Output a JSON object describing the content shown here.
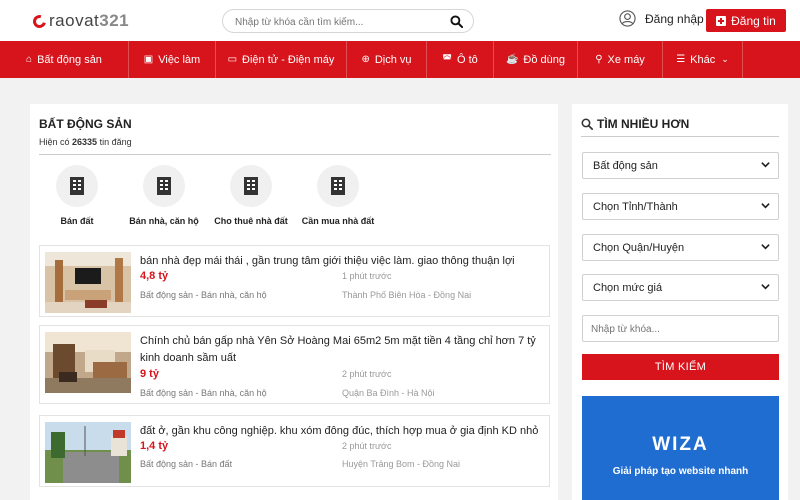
{
  "header": {
    "logo_text": "raovat",
    "logo_num": "321",
    "search_placeholder": "Nhập từ khóa cần tìm kiếm...",
    "login_label": "Đăng nhập",
    "post_label": "Đăng tin"
  },
  "nav": [
    {
      "label": "Bất động sản",
      "icon": "home-icon"
    },
    {
      "label": "Việc làm",
      "icon": "briefcase-icon"
    },
    {
      "label": "Điện tử - Điện máy",
      "icon": "monitor-icon"
    },
    {
      "label": "Dịch vụ",
      "icon": "globe-icon"
    },
    {
      "label": "Ô tô",
      "icon": "car-icon"
    },
    {
      "label": "Đồ dùng",
      "icon": "cup-icon"
    },
    {
      "label": "Xe máy",
      "icon": "motorbike-icon"
    },
    {
      "label": "Khác",
      "icon": "list-icon"
    }
  ],
  "main": {
    "title": "BẤT ĐỘNG SẢN",
    "count_prefix": "Hiện có ",
    "count": "26335",
    "count_suffix": " tin đăng",
    "categories": [
      "Bán đất",
      "Bán nhà, căn hộ",
      "Cho thuê nhà đất",
      "Cần mua nhà đất"
    ],
    "listings": [
      {
        "title": "bán nhà đẹp mái thái , gần trung tâm giới thiệu việc làm. giao thông thuận lợi",
        "price": "4,8 tỷ",
        "time": "1 phút trước",
        "category": "Bất động sản - Bán nhà, căn hộ",
        "location": "Thành Phố Biên Hòa - Đồng Nai"
      },
      {
        "title": "Chính chủ bán gấp nhà Yên Sở Hoàng Mai 65m2 5m mặt tiền 4 tầng chỉ hơn 7 tỷ kinh doanh sầm uất",
        "price": "9 tỷ",
        "time": "2 phút trước",
        "category": "Bất động sản - Bán nhà, căn hộ",
        "location": "Quận Ba Đình - Hà Nội"
      },
      {
        "title": "đất ở, gần khu công nghiệp. khu xóm đông đúc, thích hợp mua ở gia định KD nhỏ",
        "price": "1,4 tỷ",
        "time": "2 phút trước",
        "category": "Bất động sản - Bán đất",
        "location": "Huyện Trảng Bom - Đồng Nai"
      }
    ]
  },
  "sidebar": {
    "title": "TÌM NHIỀU HƠN",
    "selects": [
      "Bất động sản",
      "Chọn Tỉnh/Thành",
      "Chọn Quận/Huyện",
      "Chọn mức giá"
    ],
    "keyword_placeholder": "Nhập từ khóa...",
    "search_button": "TÌM KIẾM",
    "banner_logo": "WIZA",
    "banner_text": "Giải pháp tạo website nhanh"
  }
}
